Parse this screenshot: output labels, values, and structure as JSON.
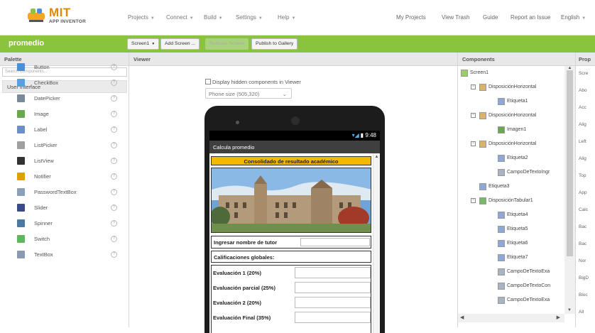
{
  "header": {
    "logo_text": "MIT",
    "logo_sub": "APP INVENTOR",
    "menus": [
      "Projects",
      "Connect",
      "Build",
      "Settings",
      "Help"
    ],
    "right_links": [
      "My Projects",
      "View Trash",
      "Guide",
      "Report an Issue",
      "English"
    ]
  },
  "toolbar": {
    "project_name": "promedio",
    "screen_select": "Screen1",
    "add_screen": "Add Screen ...",
    "remove_screen": "Remove Screen",
    "publish": "Publish to Gallery"
  },
  "palette": {
    "title": "Palette",
    "search_placeholder": "Search Components...",
    "section": "User Interface",
    "items": [
      {
        "label": "Button",
        "icon": "button-icon",
        "color": "#4a90d9"
      },
      {
        "label": "CheckBox",
        "icon": "checkbox-icon",
        "color": "#5aa0e0"
      },
      {
        "label": "DatePicker",
        "icon": "calendar-icon",
        "color": "#7a8a9a"
      },
      {
        "label": "Image",
        "icon": "image-icon",
        "color": "#6aa84f"
      },
      {
        "label": "Label",
        "icon": "label-icon",
        "color": "#6d8fc9"
      },
      {
        "label": "ListPicker",
        "icon": "list-picker-icon",
        "color": "#a0a0a0"
      },
      {
        "label": "ListView",
        "icon": "list-view-icon",
        "color": "#333333"
      },
      {
        "label": "Notifier",
        "icon": "warning-icon",
        "color": "#e0a000"
      },
      {
        "label": "PasswordTextBox",
        "icon": "password-icon",
        "color": "#8aa0b8"
      },
      {
        "label": "Slider",
        "icon": "slider-icon",
        "color": "#3a4a8a"
      },
      {
        "label": "Spinner",
        "icon": "spinner-icon",
        "color": "#4a7aa0"
      },
      {
        "label": "Switch",
        "icon": "switch-icon",
        "color": "#5cb85c"
      },
      {
        "label": "TextBox",
        "icon": "textbox-icon",
        "color": "#8a9ab0"
      }
    ]
  },
  "viewer": {
    "title": "Viewer",
    "hidden_checkbox": "Display hidden components in Viewer",
    "phone_size": "Phone size (505,320)",
    "status_time": "9:48",
    "app_title": "Calcula promedio",
    "banner": "Consolidado de resultado académico",
    "tutor_label": "Ingresar nombre de tutor",
    "global_label": "Calificaciones globales:",
    "grades": [
      "Evaluación 1 (20%)",
      "Evaluación parcial (25%)",
      "Evaluación 2 (20%)",
      "Evaluación Final (35%)"
    ]
  },
  "components": {
    "title": "Components",
    "tree": [
      {
        "label": "Screen1",
        "depth": 0,
        "toggle": "⊟",
        "icon": "screen-icon"
      },
      {
        "label": "DisposiciónHorizontal",
        "depth": 1,
        "toggle": "⊟",
        "icon": "horizontal-arrangement-icon"
      },
      {
        "label": "Etiqueta1",
        "depth": 2,
        "toggle": "",
        "icon": "label-icon"
      },
      {
        "label": "DisposiciónHorizontal",
        "depth": 1,
        "toggle": "⊟",
        "icon": "horizontal-arrangement-icon"
      },
      {
        "label": "Imagen1",
        "depth": 2,
        "toggle": "",
        "icon": "image-icon"
      },
      {
        "label": "DisposiciónHorizontal",
        "depth": 1,
        "toggle": "⊟",
        "icon": "horizontal-arrangement-icon"
      },
      {
        "label": "Etiqueta2",
        "depth": 2,
        "toggle": "",
        "icon": "label-icon"
      },
      {
        "label": "CampoDeTextoIngr",
        "depth": 2,
        "toggle": "",
        "icon": "textbox-icon"
      },
      {
        "label": "Etiqueta3",
        "depth": 1,
        "toggle": "",
        "icon": "label-icon"
      },
      {
        "label": "DisposiciónTabular1",
        "depth": 1,
        "toggle": "⊟",
        "icon": "table-arrangement-icon"
      },
      {
        "label": "Etiqueta4",
        "depth": 2,
        "toggle": "",
        "icon": "label-icon"
      },
      {
        "label": "Etiqueta5",
        "depth": 2,
        "toggle": "",
        "icon": "label-icon"
      },
      {
        "label": "Etiqueta6",
        "depth": 2,
        "toggle": "",
        "icon": "label-icon"
      },
      {
        "label": "Etiqueta7",
        "depth": 2,
        "toggle": "",
        "icon": "label-icon"
      },
      {
        "label": "CampoDeTextoExa",
        "depth": 2,
        "toggle": "",
        "icon": "textbox-icon"
      },
      {
        "label": "CampoDeTextoCon",
        "depth": 2,
        "toggle": "",
        "icon": "textbox-icon"
      },
      {
        "label": "CampoDeTextoExa",
        "depth": 2,
        "toggle": "",
        "icon": "textbox-icon"
      }
    ]
  },
  "properties": {
    "title": "Prop",
    "lines": [
      "Scre",
      "Abo",
      "Acc",
      "Alig",
      "Left",
      "Alig",
      "Top",
      "App",
      "Calc",
      "Bac",
      "Bac",
      "Nor",
      "BigD",
      "Bloc",
      "All"
    ]
  }
}
